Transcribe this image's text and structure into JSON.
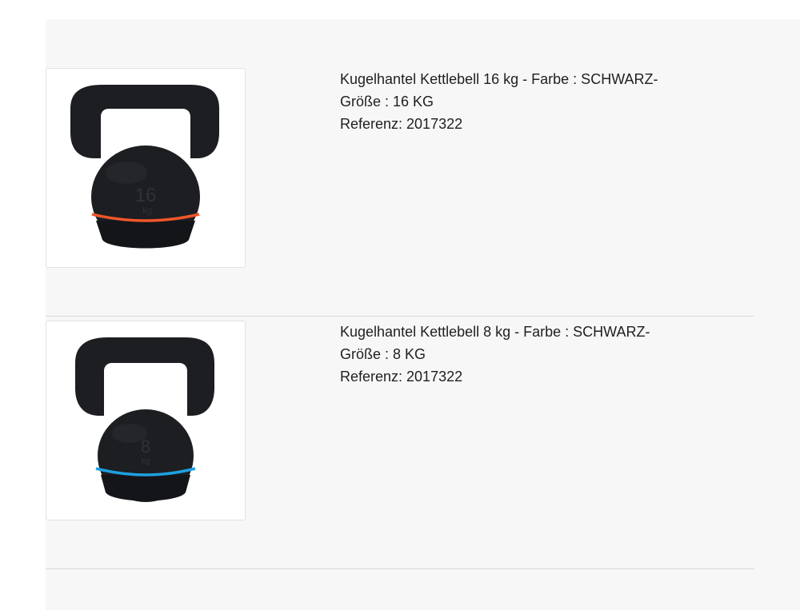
{
  "products": [
    {
      "title": "Kugelhantel Kettlebell 16 kg - Farbe : SCHWARZ-",
      "size": "Größe : 16 KG",
      "reference": "Referenz: 2017322",
      "weight_mark": "16",
      "unit_mark": "kg",
      "accent_color": "#f0562a",
      "image_icon": "kettlebell-icon"
    },
    {
      "title": "Kugelhantel Kettlebell 8 kg - Farbe : SCHWARZ-",
      "size": "Größe : 8 KG",
      "reference": "Referenz: 2017322",
      "weight_mark": "8",
      "unit_mark": "kg",
      "accent_color": "#1ea0e0",
      "image_icon": "kettlebell-icon"
    }
  ],
  "colors": {
    "panel_background": "#f7f7f7",
    "kettlebell_body": "#1c1e21"
  }
}
